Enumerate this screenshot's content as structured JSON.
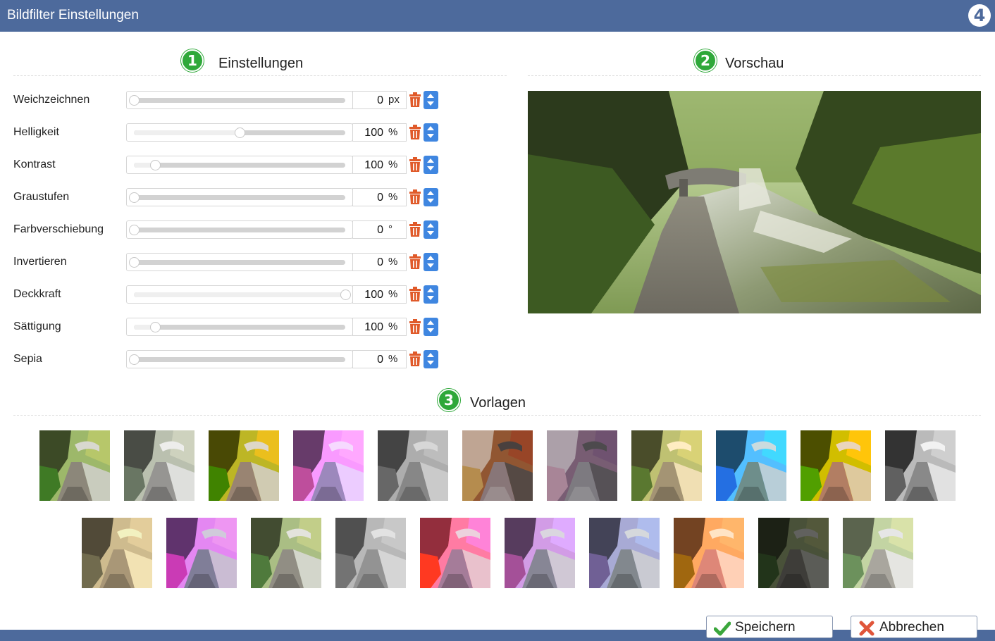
{
  "window": {
    "title": "Bildfilter Einstellungen",
    "logo_text": "4"
  },
  "sections": {
    "settings": {
      "number": "1",
      "title": "Einstellungen"
    },
    "preview": {
      "number": "2",
      "title": "Vorschau"
    },
    "templates": {
      "number": "3",
      "title": "Vorlagen"
    }
  },
  "filters": [
    {
      "label": "Weichzeichnen",
      "value": "0",
      "unit": "px",
      "level": 0
    },
    {
      "label": "Helligkeit",
      "value": "100",
      "unit": "%",
      "level": 0.5
    },
    {
      "label": "Kontrast",
      "value": "100",
      "unit": "%",
      "level": 0.1
    },
    {
      "label": "Graustufen",
      "value": "0",
      "unit": "%",
      "level": 0
    },
    {
      "label": "Farbverschiebung",
      "value": "0",
      "unit": "°",
      "level": 0
    },
    {
      "label": "Invertieren",
      "value": "0",
      "unit": "%",
      "level": 0
    },
    {
      "label": "Deckkraft",
      "value": "100",
      "unit": "%",
      "level": 1
    },
    {
      "label": "Sättigung",
      "value": "100",
      "unit": "%",
      "level": 0.1
    },
    {
      "label": "Sepia",
      "value": "0",
      "unit": "%",
      "level": 0
    }
  ],
  "templates": {
    "row1": [
      "none",
      "grayscale-light",
      "green-yellow",
      "purple",
      "grayscale",
      "inverted-pink",
      "inverted-blue",
      "warm-vintage",
      "cyan",
      "high-saturation",
      "monochrome-dark"
    ],
    "row2": [
      "sepia",
      "blue-purple",
      "desaturated-green",
      "grayscale-soft",
      "magenta",
      "violet",
      "cool-blue",
      "red-tint",
      "dark",
      "faded-light"
    ]
  },
  "buttons": {
    "save": "Speichern",
    "cancel": "Abbrechen"
  },
  "colors": {
    "titlebar": "#4d6a9c",
    "badge": "#2fa83a",
    "spinner": "#3f86e0",
    "delete": "#e05a2a",
    "save_icon": "#3aa63c",
    "cancel_icon": "#e0553a"
  }
}
